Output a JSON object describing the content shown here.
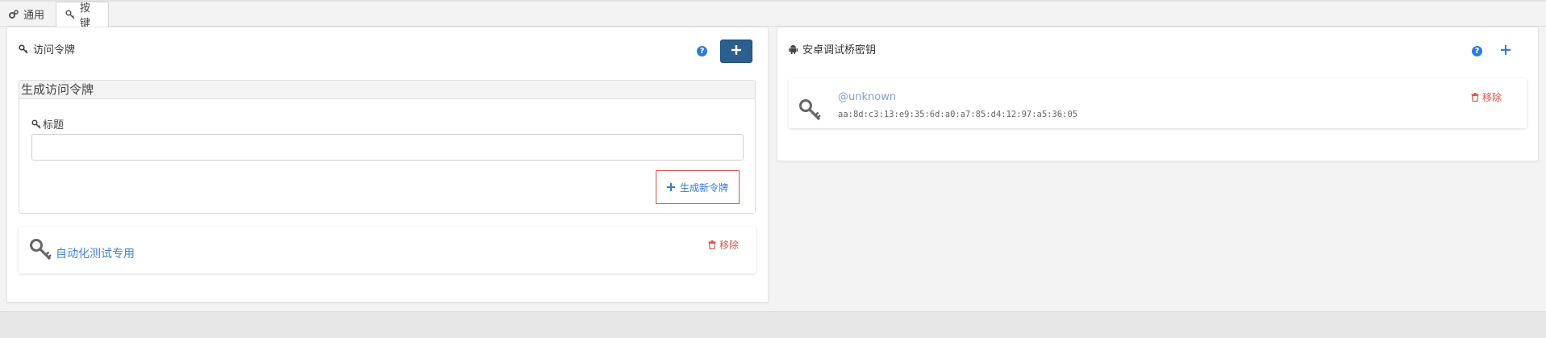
{
  "tabs": [
    {
      "label": "通用",
      "icon": "gears-icon",
      "active": false
    },
    {
      "label": "按键",
      "icon": "key-icon",
      "active": true
    }
  ],
  "access_tokens": {
    "title": "访问令牌",
    "help_glyph": "?",
    "generate": {
      "header": "生成访问令牌",
      "field_label": "标题",
      "field_value": "",
      "field_placeholder": "",
      "button_label": "生成新令牌"
    },
    "tokens": [
      {
        "name": "自动化测试专用",
        "remove_label": "移除"
      }
    ]
  },
  "adb_keys": {
    "title": "安卓调试桥密钥",
    "help_glyph": "?",
    "keys": [
      {
        "user": "@unknown",
        "fingerprint": "aa:8d:c3:13:e9:35:6d:a0:a7:85:d4:12:97:a5:36:05",
        "remove_label": "移除"
      }
    ]
  },
  "colors": {
    "accent": "#2f7bd6",
    "primary_button": "#2c5f8d",
    "danger": "#d9534f",
    "link": "#4a86c8"
  }
}
